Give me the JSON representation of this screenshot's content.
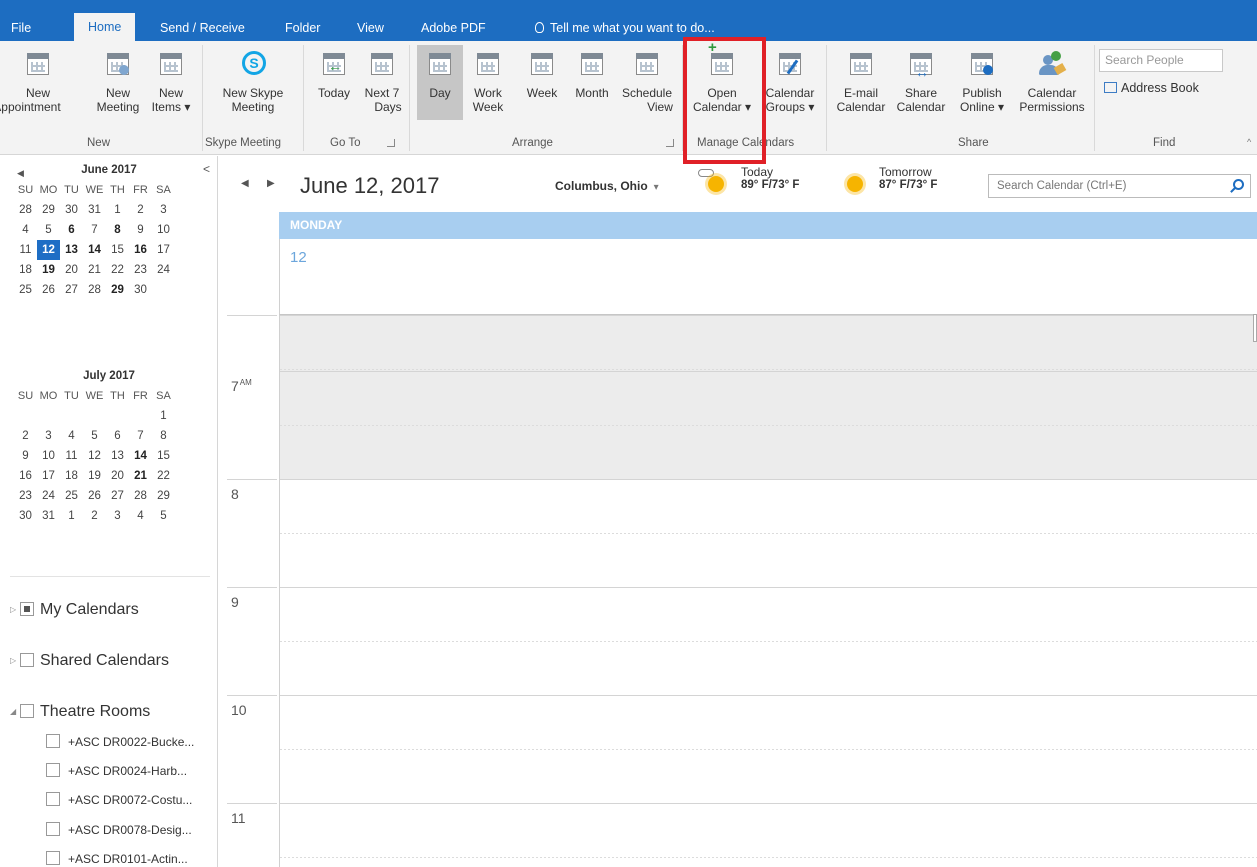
{
  "tabs": [
    "File",
    "Home",
    "Send / Receive",
    "Folder",
    "View",
    "Adobe PDF"
  ],
  "tellme": "Tell me what you want to do...",
  "ribbon": {
    "new_appointment": [
      "New",
      "Appointment"
    ],
    "new_meeting": [
      "New",
      "Meeting"
    ],
    "new_items": [
      "New",
      "Items ▾"
    ],
    "new_skype": [
      "New Skype",
      "Meeting"
    ],
    "today": "Today",
    "next7": [
      "Next 7",
      "Days"
    ],
    "day": "Day",
    "work_week": [
      "Work",
      "Week"
    ],
    "week": "Week",
    "month": "Month",
    "schedule_view": [
      "Schedule",
      "View"
    ],
    "open_calendar": [
      "Open",
      "Calendar ▾"
    ],
    "calendar_groups": [
      "Calendar",
      "Groups ▾"
    ],
    "email_calendar": [
      "E-mail",
      "Calendar"
    ],
    "share_calendar": [
      "Share",
      "Calendar"
    ],
    "publish_online": [
      "Publish",
      "Online ▾"
    ],
    "calendar_permissions": [
      "Calendar",
      "Permissions"
    ],
    "search_people_placeholder": "Search People",
    "address_book": "Address Book",
    "groups": {
      "new": "New",
      "skype": "Skype Meeting",
      "goto": "Go To",
      "arrange": "Arrange",
      "manage": "Manage Calendars",
      "share": "Share",
      "find": "Find"
    }
  },
  "mini_june": {
    "title": "June 2017",
    "dow": [
      "SU",
      "MO",
      "TU",
      "WE",
      "TH",
      "FR",
      "SA"
    ],
    "weeks": [
      [
        "28",
        "29",
        "30",
        "31",
        "1",
        "2",
        "3"
      ],
      [
        "4",
        "5",
        "6",
        "7",
        "8",
        "9",
        "10"
      ],
      [
        "11",
        "12",
        "13",
        "14",
        "15",
        "16",
        "17"
      ],
      [
        "18",
        "19",
        "20",
        "21",
        "22",
        "23",
        "24"
      ],
      [
        "25",
        "26",
        "27",
        "28",
        "29",
        "30",
        ""
      ]
    ]
  },
  "mini_july": {
    "title": "July 2017",
    "dow": [
      "SU",
      "MO",
      "TU",
      "WE",
      "TH",
      "FR",
      "SA"
    ],
    "weeks": [
      [
        "",
        "",
        "",
        "",
        "",
        "",
        "1"
      ],
      [
        "2",
        "3",
        "4",
        "5",
        "6",
        "7",
        "8"
      ],
      [
        "9",
        "10",
        "11",
        "12",
        "13",
        "14",
        "15"
      ],
      [
        "16",
        "17",
        "18",
        "19",
        "20",
        "21",
        "22"
      ],
      [
        "23",
        "24",
        "25",
        "26",
        "27",
        "28",
        "29"
      ],
      [
        "30",
        "31",
        "1",
        "2",
        "3",
        "4",
        "5"
      ]
    ]
  },
  "folders": {
    "my_calendars": "My Calendars",
    "shared_calendars": "Shared Calendars",
    "theatre_rooms": "Theatre Rooms",
    "rooms": [
      "+ASC DR0022-Bucke...",
      "+ASC DR0024-Harb...",
      "+ASC DR0072-Costu...",
      "+ASC DR0078-Desig...",
      "+ASC DR0101-Actin..."
    ]
  },
  "main": {
    "date": "June 12, 2017",
    "location": "Columbus, Ohio",
    "today_label": "Today",
    "today_temp": "89° F/73° F",
    "tomorrow_label": "Tomorrow",
    "tomorrow_temp": "87° F/73° F",
    "search_placeholder": "Search Calendar (Ctrl+E)",
    "day_name": "MONDAY",
    "day_num": "12",
    "hours": [
      "7",
      "8",
      "9",
      "10",
      "11"
    ],
    "am": "AM"
  }
}
